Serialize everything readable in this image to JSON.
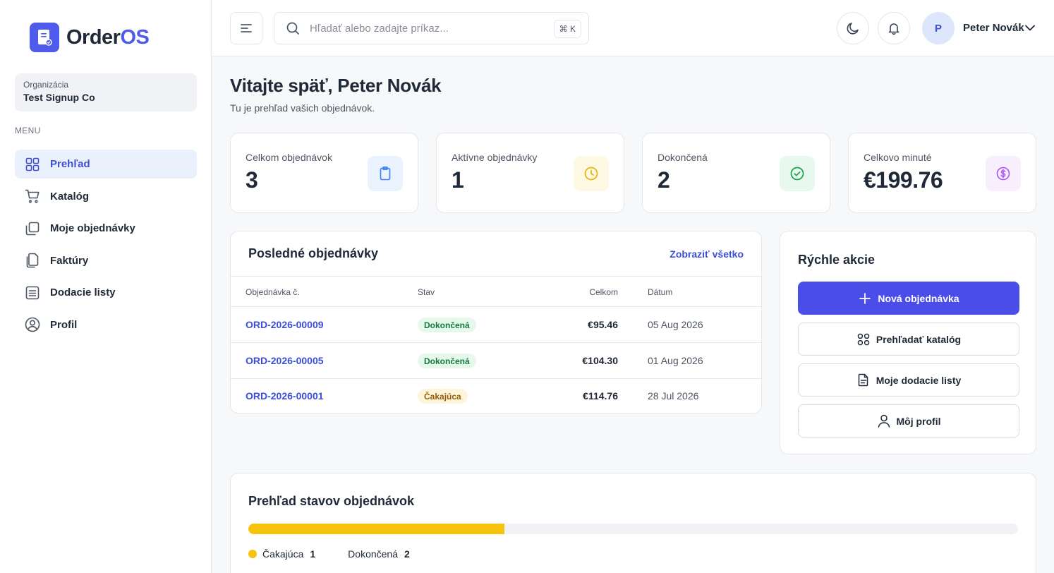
{
  "app": {
    "name_part1": "Order",
    "name_part2": "OS"
  },
  "organization": {
    "label": "Organizácia",
    "name": "Test Signup Co"
  },
  "menu": {
    "label": "MENU",
    "items": [
      {
        "label": "Prehľad",
        "icon": "grid-icon",
        "active": true
      },
      {
        "label": "Katalóg",
        "icon": "cart-icon"
      },
      {
        "label": "Moje objednávky",
        "icon": "copy-icon"
      },
      {
        "label": "Faktúry",
        "icon": "documents-icon"
      },
      {
        "label": "Dodacie listy",
        "icon": "list-icon"
      },
      {
        "label": "Profil",
        "icon": "user-circle-icon"
      }
    ]
  },
  "header": {
    "search_placeholder": "Hľadať alebo zadajte príkaz...",
    "shortcut": "⌘ K",
    "user_initial": "P",
    "user_name": "Peter Novák"
  },
  "welcome": {
    "title": "Vitajte späť, Peter Novák",
    "subtitle": "Tu je prehľad vašich objednávok."
  },
  "stats": [
    {
      "label": "Celkom objednávok",
      "value": "3",
      "icon": "clipboard-icon",
      "color": "#3b82f6",
      "bg": "#eaf2fe"
    },
    {
      "label": "Aktívne objednávky",
      "value": "1",
      "icon": "clock-icon",
      "color": "#eab308",
      "bg": "#fef9e3"
    },
    {
      "label": "Dokončená",
      "value": "2",
      "icon": "check-circle-icon",
      "color": "#16a34a",
      "bg": "#e9f8ee"
    },
    {
      "label": "Celkovo minuté",
      "value": "€199.76",
      "icon": "dollar-icon",
      "color": "#a855f7",
      "bg": "#f7eefe"
    }
  ],
  "recent_orders": {
    "title": "Posledné objednávky",
    "view_all": "Zobraziť všetko",
    "columns": {
      "number": "Objednávka č.",
      "status": "Stav",
      "total": "Celkom",
      "date": "Dátum"
    },
    "rows": [
      {
        "number": "ORD-2026-00009",
        "status": "Dokončená",
        "status_type": "done",
        "total": "€95.46",
        "date": "05 Aug 2026"
      },
      {
        "number": "ORD-2026-00005",
        "status": "Dokončená",
        "status_type": "done",
        "total": "€104.30",
        "date": "01 Aug 2026"
      },
      {
        "number": "ORD-2026-00001",
        "status": "Čakajúca",
        "status_type": "wait",
        "total": "€114.76",
        "date": "28 Jul 2026"
      }
    ]
  },
  "quick_actions": {
    "title": "Rýchle akcie",
    "buttons": [
      {
        "label": "Nová objednávka",
        "icon": "plus-icon",
        "primary": true
      },
      {
        "label": "Prehľadať katalóg",
        "icon": "grid-icon"
      },
      {
        "label": "Moje dodacie listy",
        "icon": "document-icon"
      },
      {
        "label": "Môj profil",
        "icon": "user-icon"
      }
    ]
  },
  "status_overview": {
    "title": "Prehľad stavov objednávok",
    "pending_fraction": 0.333,
    "pending_color": "#f7c20c",
    "legend": [
      {
        "label": "Čakajúca",
        "count": "1",
        "color": "#f7c20c"
      },
      {
        "label": "Dokončená",
        "count": "2",
        "color": ""
      }
    ]
  }
}
